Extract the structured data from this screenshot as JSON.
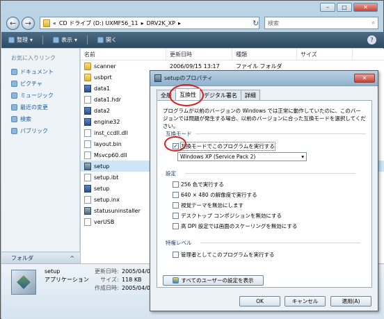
{
  "nav": {
    "back_arrow": "←",
    "forward_arrow": "→",
    "dropdown": "▾"
  },
  "address": {
    "prefix": "«",
    "segments": [
      "CD ドライブ (D:) UXMF56_11",
      "DRV2K_XP"
    ],
    "separator": "▸",
    "refresh": "↻"
  },
  "search": {
    "placeholder": "検索",
    "icon": "⌕"
  },
  "caption": {
    "min": "–",
    "max": "□",
    "close": "✕"
  },
  "toolbar": {
    "organize": "整理",
    "view": "表示",
    "open": "開く",
    "dd": "▾",
    "help": "?"
  },
  "sidebar": {
    "header": "お気に入りリンク",
    "items": [
      "ドキュメント",
      "ピクチャ",
      "ミュージック",
      "最近の変更",
      "検索",
      "パブリック"
    ],
    "folders_label": "フォルダ",
    "folders_chevron": "^"
  },
  "columns": [
    "名前",
    "更新日時",
    "種類",
    "サイズ"
  ],
  "files": [
    {
      "name": "scanner",
      "date": "2006/09/15 13:17",
      "type": "ファイル フォルダ",
      "kind": "folder"
    },
    {
      "name": "usbprt",
      "date": "",
      "type": "",
      "kind": "folder"
    },
    {
      "name": "data1",
      "date": "",
      "type": "",
      "kind": "app"
    },
    {
      "name": "data1.hdr",
      "date": "",
      "type": "",
      "kind": "doc"
    },
    {
      "name": "data2",
      "date": "",
      "type": "",
      "kind": "app"
    },
    {
      "name": "engine32",
      "date": "",
      "type": "",
      "kind": "app"
    },
    {
      "name": "inst_ccdll.dll",
      "date": "",
      "type": "",
      "kind": "doc"
    },
    {
      "name": "layout.bin",
      "date": "",
      "type": "",
      "kind": "doc"
    },
    {
      "name": "Msvcp60.dll",
      "date": "",
      "type": "",
      "kind": "doc"
    },
    {
      "name": "setup",
      "date": "",
      "type": "",
      "kind": "setup",
      "selected": true
    },
    {
      "name": "setup.ibt",
      "date": "",
      "type": "",
      "kind": "doc"
    },
    {
      "name": "setup",
      "date": "",
      "type": "",
      "kind": "app"
    },
    {
      "name": "setup.inx",
      "date": "",
      "type": "",
      "kind": "doc"
    },
    {
      "name": "statusuninstaller",
      "date": "",
      "type": "",
      "kind": "setup"
    },
    {
      "name": "verUSB",
      "date": "",
      "type": "",
      "kind": "doc"
    }
  ],
  "details": {
    "name": "setup",
    "kind": "アプリケーション",
    "modified_label": "更新日時:",
    "modified": "2005/04/07",
    "size_label": "サイズ:",
    "size": "118 KB",
    "created_label": "作成日時:",
    "created": "2005/04/07"
  },
  "dialog": {
    "title": "setupのプロパティ",
    "close": "✕",
    "tabs": [
      "全般",
      "互換性",
      "デジタル署名",
      "詳細"
    ],
    "intro": "プログラムが以前のバージョンの Windows では正常に動作していたのに、このバージョンでは問題が発生する場合、以前のバージョンに合った互換モードを選択してください。",
    "compat_group": "互換モード",
    "compat_check": "互換モードでこのプログラムを実行する",
    "check_mark": "✓",
    "os_select": "Windows XP (Service Pack 2)",
    "combo_arrow": "▾",
    "settings_group": "設定",
    "settings": [
      "256 色で実行する",
      "640 × 480 の解像度で実行する",
      "視覚テーマを無効にします",
      "デスクトップ コンポジションを無効にする",
      "高 DPI 設定では画面のスケーリングを無効にする"
    ],
    "privilege_group": "特権レベル",
    "admin_check": "管理者としてこのプログラムを実行する",
    "all_users_btn": "すべてのユーザーの設定を表示",
    "ok": "OK",
    "cancel": "キャンセル",
    "apply": "適用(A)"
  }
}
